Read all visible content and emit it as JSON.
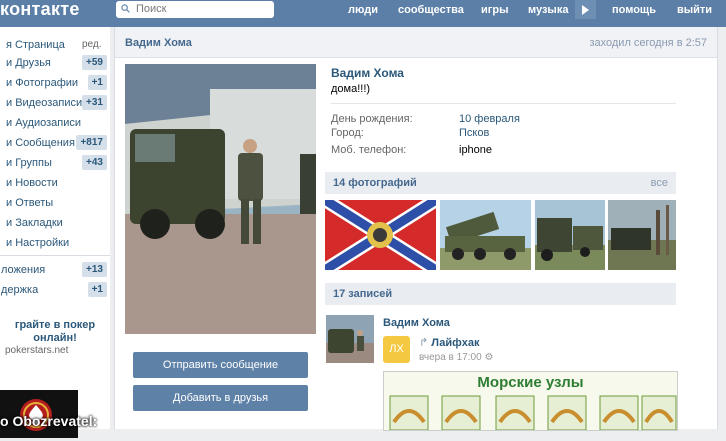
{
  "header": {
    "logo": "контакте",
    "search_placeholder": "Поиск",
    "nav": [
      "люди",
      "сообщества",
      "игры",
      "музыка",
      "помощь",
      "выйти"
    ],
    "nav_more_icon": "triangle-right-icon"
  },
  "sidebar": {
    "edit_label": "ред.",
    "items": [
      {
        "label": "я Страница",
        "count": ""
      },
      {
        "label": "и Друзья",
        "count": "+59"
      },
      {
        "label": "и Фотографии",
        "count": "+1"
      },
      {
        "label": "и Видеозаписи",
        "count": "+31"
      },
      {
        "label": "и Аудиозаписи",
        "count": ""
      },
      {
        "label": "и Сообщения",
        "count": "+817"
      },
      {
        "label": "и Группы",
        "count": "+43"
      },
      {
        "label": "и Новости",
        "count": ""
      },
      {
        "label": "и Ответы",
        "count": ""
      },
      {
        "label": "и Закладки",
        "count": ""
      },
      {
        "label": "и Настройки",
        "count": ""
      }
    ],
    "apps": [
      {
        "label": "ложения",
        "count": "+13"
      },
      {
        "label": "держка",
        "count": "+1"
      }
    ],
    "ad_title": "грайте в покер онлайн!",
    "ad_sub": "pokerstars.net"
  },
  "page": {
    "header_name": "Вадим Хома",
    "header_status": "заходил сегодня в 2:57",
    "name": "Вадим Хома",
    "status": "дома!!!)",
    "info": [
      {
        "label": "День рождения:",
        "value": "10 февраля",
        "link": true
      },
      {
        "label": "Город:",
        "value": "Псков",
        "link": true
      },
      {
        "label": "Моб. телефон:",
        "value": "iphone",
        "link": false
      }
    ],
    "buttons": {
      "message": "Отправить сообщение",
      "add_friend": "Добавить в друзья"
    },
    "photos": {
      "title": "14 фотографий",
      "all": "все"
    },
    "wall": {
      "title": "17 записей"
    },
    "post": {
      "author": "Вадим Хома",
      "repost_icon_text": "ЛХ",
      "repost_mark": "↱",
      "repost_source": "Лайфхак",
      "time": "вчера в 17:00",
      "image_title": "Морские узлы"
    }
  },
  "watermark": "о Obozrevatel:",
  "colors": {
    "header_bg": "#5b7fa6",
    "link": "#2b587a",
    "button": "#5e81a8",
    "badge": "#d4dfea"
  }
}
